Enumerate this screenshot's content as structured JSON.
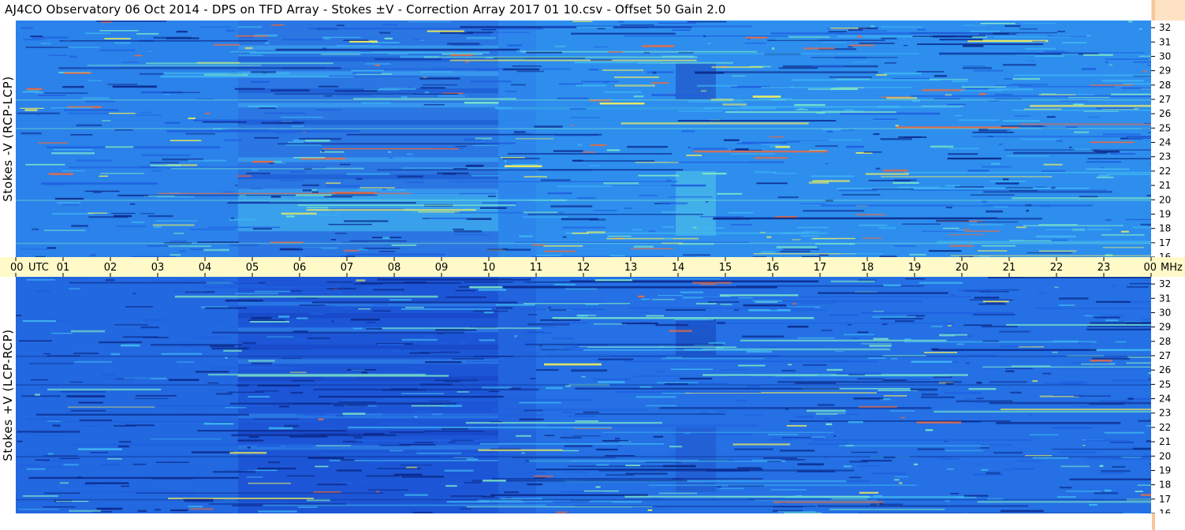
{
  "title": "AJ4CO Observatory  06 Oct 2014  -  DPS on TFD Array  -  Stokes ±V  -  Correction Array 2017 01 10.csv  -  Offset 50  Gain 2.0",
  "chart_data": [
    {
      "type": "heatmap",
      "ylabel": "Stokes -V (RCP-LCP)",
      "xlabel": "UTC",
      "x_ticks": [
        "00",
        "01",
        "02",
        "03",
        "04",
        "05",
        "06",
        "07",
        "08",
        "09",
        "10",
        "11",
        "12",
        "13",
        "14",
        "15",
        "16",
        "17",
        "18",
        "19",
        "20",
        "21",
        "22",
        "23",
        "00"
      ],
      "x_range": [
        0,
        24
      ],
      "y_ticks": [
        "16",
        "17",
        "18",
        "19",
        "20",
        "21",
        "22",
        "23",
        "24",
        "25",
        "26",
        "27",
        "28",
        "29",
        "30",
        "31",
        "32"
      ],
      "y_unit": "MHz",
      "y_range": [
        16,
        32.5
      ],
      "colorscale": [
        "#0b2a8c",
        "#1f5fe0",
        "#2a86ee",
        "#3fb6f2",
        "#7de8c8",
        "#f4f05a",
        "#f06a3a"
      ]
    },
    {
      "type": "heatmap",
      "ylabel": "Stokes +V (LCP-RCP)",
      "xlabel": "UTC",
      "x_ticks": [
        "00",
        "01",
        "02",
        "03",
        "04",
        "05",
        "06",
        "07",
        "08",
        "09",
        "10",
        "11",
        "12",
        "13",
        "14",
        "15",
        "16",
        "17",
        "18",
        "19",
        "20",
        "21",
        "22",
        "23",
        "00"
      ],
      "x_range": [
        0,
        24
      ],
      "y_ticks": [
        "16",
        "17",
        "18",
        "19",
        "20",
        "21",
        "22",
        "23",
        "24",
        "25",
        "26",
        "27",
        "28",
        "29",
        "30",
        "31",
        "32"
      ],
      "y_unit": "MHz",
      "y_range": [
        16,
        32.5
      ],
      "colorscale": [
        "#0b2a8c",
        "#1f5fe0",
        "#2a86ee",
        "#3fb6f2",
        "#7de8c8",
        "#f4f05a",
        "#f06a3a"
      ]
    }
  ],
  "axis": {
    "time_prefix_label": "UTC",
    "freq_unit_label": "MHz"
  }
}
